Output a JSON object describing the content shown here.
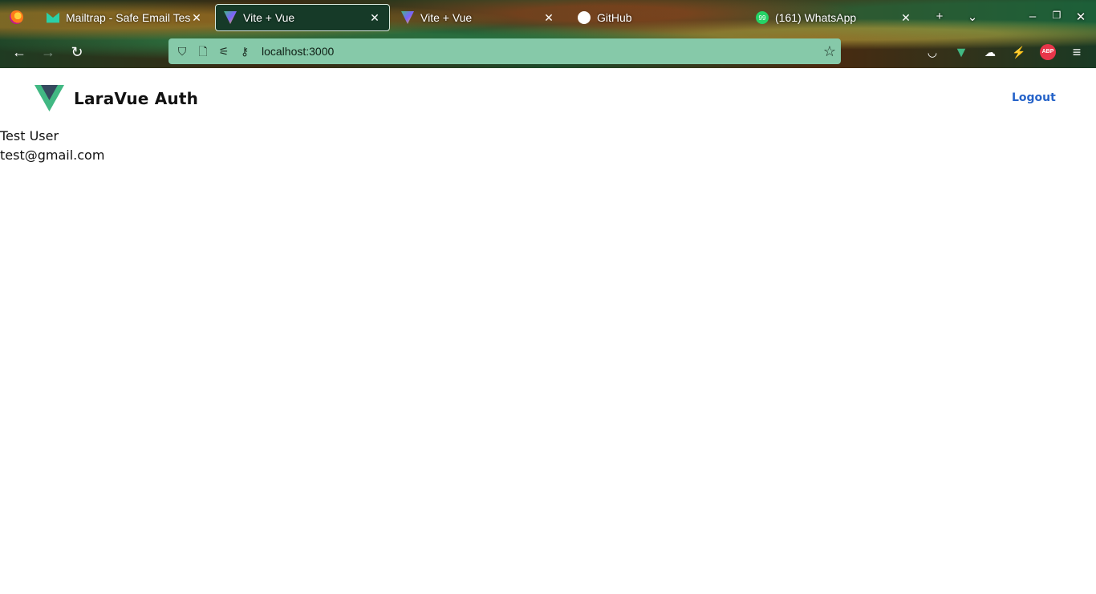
{
  "browser": {
    "tabs": [
      {
        "title": "Mailtrap - Safe Email Tes",
        "favicon": "mailtrap-icon",
        "active": false
      },
      {
        "title": "Vite + Vue",
        "favicon": "vite-icon",
        "active": true
      },
      {
        "title": "Vite + Vue",
        "favicon": "vite-icon",
        "active": false
      },
      {
        "title": "GitHub",
        "favicon": "github-icon",
        "active": false
      },
      {
        "title": "(161) WhatsApp",
        "favicon": "whatsapp-icon",
        "active": false,
        "badge": "99"
      }
    ],
    "url": "localhost:3000",
    "extensions": {
      "abp_label": "ABP"
    }
  },
  "app": {
    "brand": "LaraVue Auth",
    "logout_label": "Logout",
    "accent_color": "#2563c9",
    "user": {
      "name": "Test User",
      "email": "test@gmail.com"
    }
  }
}
